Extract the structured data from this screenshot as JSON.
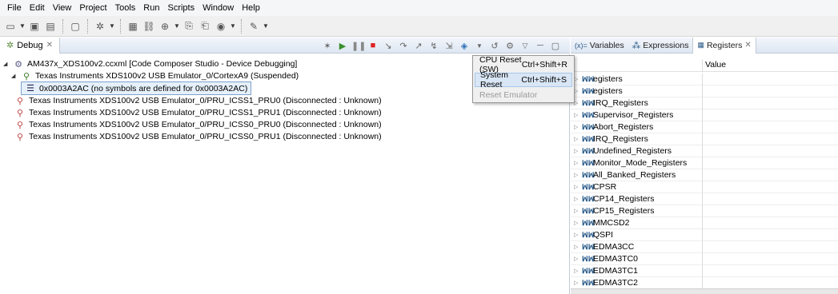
{
  "menu_bar": [
    "File",
    "Edit",
    "View",
    "Project",
    "Tools",
    "Run",
    "Scripts",
    "Window",
    "Help"
  ],
  "debug_view": {
    "tab_label": "Debug",
    "tree": [
      {
        "text": "AM437x_XDS100v2.ccxml [Code Composer Studio - Device Debugging]"
      },
      {
        "text": "Texas Instruments XDS100v2 USB Emulator_0/CortexA9 (Suspended)"
      },
      {
        "text": "0x0003A2AC  (no symbols are defined for 0x0003A2AC)"
      },
      {
        "text": "Texas Instruments XDS100v2 USB Emulator_0/PRU_ICSS1_PRU0 (Disconnected : Unknown)"
      },
      {
        "text": "Texas Instruments XDS100v2 USB Emulator_0/PRU_ICSS1_PRU1 (Disconnected : Unknown)"
      },
      {
        "text": "Texas Instruments XDS100v2 USB Emulator_0/PRU_ICSS0_PRU0 (Disconnected : Unknown)"
      },
      {
        "text": "Texas Instruments XDS100v2 USB Emulator_0/PRU_ICSS0_PRU1 (Disconnected : Unknown)"
      }
    ]
  },
  "reset_menu": [
    {
      "label": "CPU Reset (SW)",
      "shortcut": "Ctrl+Shift+R"
    },
    {
      "label": "System Reset",
      "shortcut": "Ctrl+Shift+S"
    },
    {
      "label": "Reset Emulator",
      "shortcut": ""
    }
  ],
  "right_tabs": {
    "variables": "Variables",
    "expressions": "Expressions",
    "registers": "Registers"
  },
  "registers": {
    "value_header": "Value",
    "partial_rows": [
      "egisters",
      "egisters",
      "IRQ_Registers"
    ],
    "rows": [
      "Supervisor_Registers",
      "Abort_Registers",
      "IRQ_Registers",
      "Undefined_Registers",
      "Monitor_Mode_Registers",
      "All_Banked_Registers",
      "CPSR",
      "CP14_Registers",
      "CP15_Registers",
      "MMCSD2",
      "QSPI",
      "EDMA3CC",
      "EDMA3TC0",
      "EDMA3TC1",
      "EDMA3TC2"
    ]
  }
}
